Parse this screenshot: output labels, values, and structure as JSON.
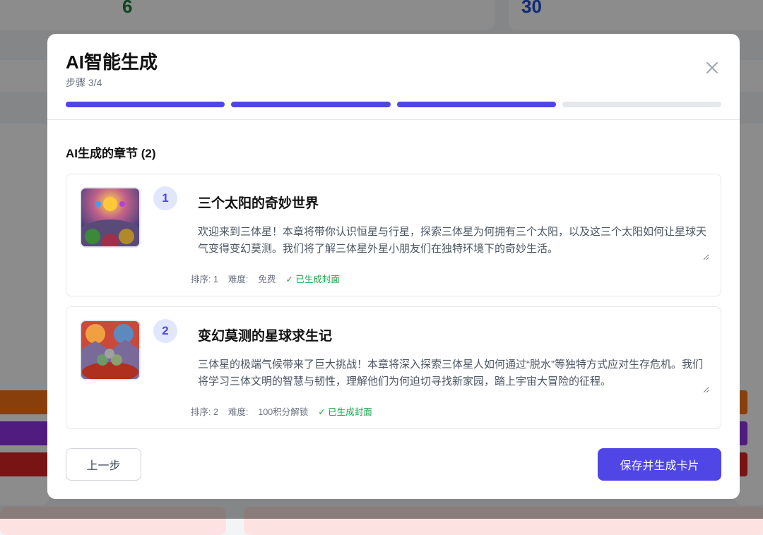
{
  "background": {
    "stat1": "6",
    "stat2": "30"
  },
  "modal": {
    "title": "AI智能生成",
    "step": "步骤 3/4",
    "progress": {
      "current": 3,
      "total": 4
    },
    "section_title": "AI生成的章节 (2)",
    "chapters": [
      {
        "index": "1",
        "title": "三个太阳的奇妙世界",
        "description": "欢迎来到三体星！本章将带你认识恒星与行星，探索三体星为何拥有三个太阳，以及这三个太阳如何让星球天气变得变幻莫测。我们将了解三体星外星小朋友们在独特环境下的奇妙生活。",
        "order": "排序: 1",
        "difficulty_label": "难度:",
        "difficulty": "免费",
        "cover_status": "✓ 已生成封面"
      },
      {
        "index": "2",
        "title": "变幻莫测的星球求生记",
        "description": "三体星的极端气候带来了巨大挑战！本章将深入探索三体星人如何通过“脱水”等独特方式应对生存危机。我们将学习三体文明的智慧与韧性，理解他们为何迫切寻找新家园，踏上宇宙大冒险的征程。",
        "order": "排序: 2",
        "difficulty_label": "难度:",
        "difficulty": "100积分解锁",
        "cover_status": "✓ 已生成封面"
      }
    ],
    "prev_label": "上一步",
    "save_label": "保存并生成卡片"
  },
  "colors": {
    "accent": "#4f46e5",
    "inactive": "#e5e7eb",
    "success": "#16a34a"
  }
}
